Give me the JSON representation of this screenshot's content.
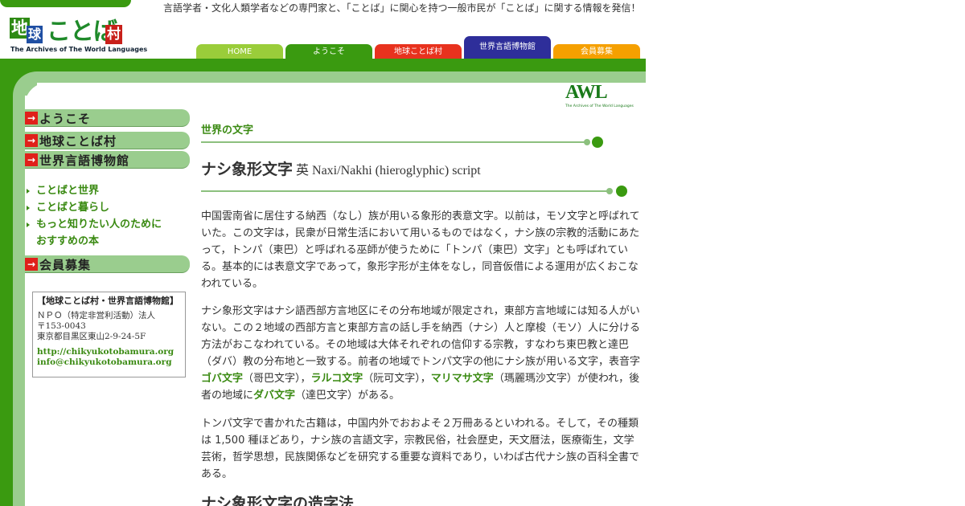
{
  "logo": {
    "k1": "地",
    "k2": "球",
    "k3": "ことば",
    "k4": "村",
    "subtitle": "The Archives of The World Languages"
  },
  "tagline": "言語学者・文化人類学者などの専門家と、「ことば」に関心を持つ一般市民が「ことば」に関する情報を発信！",
  "nav_tabs": [
    {
      "label": "HOME",
      "color": "#9acd3a"
    },
    {
      "label": "ようこそ",
      "color": "#3a9a10"
    },
    {
      "label": "地球ことば村",
      "color": "#e8321e"
    },
    {
      "label": "世界言語博物館",
      "color": "#2e2e9a"
    },
    {
      "label": "会員募集",
      "color": "#f5a000"
    }
  ],
  "sidebar": {
    "buttons": [
      "ようこそ",
      "地球ことば村",
      "世界言語博物館"
    ],
    "links": [
      "ことばと世界",
      "ことばと暮らし",
      "もっと知りたい人のために",
      "おすすめの本"
    ],
    "member_button": "会員募集",
    "arrow_glyph": "→"
  },
  "infobox": {
    "title": "【地球ことば村・世界言語博物館】",
    "org": "ＮＰＯ（特定非営利活動）法人",
    "zip": "〒153-0043",
    "address": "東京都目黒区東山2-9-24-5F",
    "url": "http://chikyukotobamura.org",
    "email": "info@chikyukotobamura.org"
  },
  "awl_logo": {
    "text": "AWL",
    "sub": "The Archives of The World Languages"
  },
  "section_label": "世界の文字",
  "title": {
    "jp": "ナシ象形文字",
    "en": " 英 Naxi/Nakhi (hieroglyphic) script"
  },
  "paragraphs": {
    "p1": "中国雲南省に居住する納西（なし）族が用いる象形的表意文字。以前は，モソ文字と呼ばれていた。この文字は，民衆が日常生活において用いるものではなく，ナシ族の宗教的活動にあたって，トンパ（東巴）と呼ばれる巫師が使うために「トンパ（東巴）文字」とも呼ばれている。基本的には表意文字であって，象形字形が主体をなし，同音仮借による運用が広くおこなわれている。",
    "p2_a": "ナシ象形文字はナシ語西部方言地区にその分布地域が限定され，東部方言地域には知る人がいない。この２地域の西部方言と東部方言の話し手を納西（ナシ）人と摩梭（モソ）人に分ける方法がおこなわれている。その地域は大体それぞれの信仰する宗教，すなわち東巴教と達巴（ダバ）教の分布地と一致する。前者の地域でトンパ文字の他にナシ族が用いる文字，表音字",
    "link1": "ゴバ文字",
    "p2_b": "（哥巴文字），",
    "link2": "ラルコ文字",
    "p2_c": "（阮可文字），",
    "link3": "マリマサ文字",
    "p2_d": "（瑪麗瑪沙文字）が使われ，後者の地域に",
    "link4": "ダバ文字",
    "p2_e": "（達巴文字）がある。",
    "p3": "トンパ文字で書かれた古籍は，中国内外でおおよそ２万冊あるといわれる。そして，その種類は 1,500 種ほどあり，ナシ族の言語文字，宗教民俗，社会歴史，天文暦法，医療衛生，文学芸術，哲学思想，民族関係などを研究する重要な資料であり，いわば古代ナシ族の百科全書である。"
  },
  "h2": "ナシ象形文字の造字法"
}
